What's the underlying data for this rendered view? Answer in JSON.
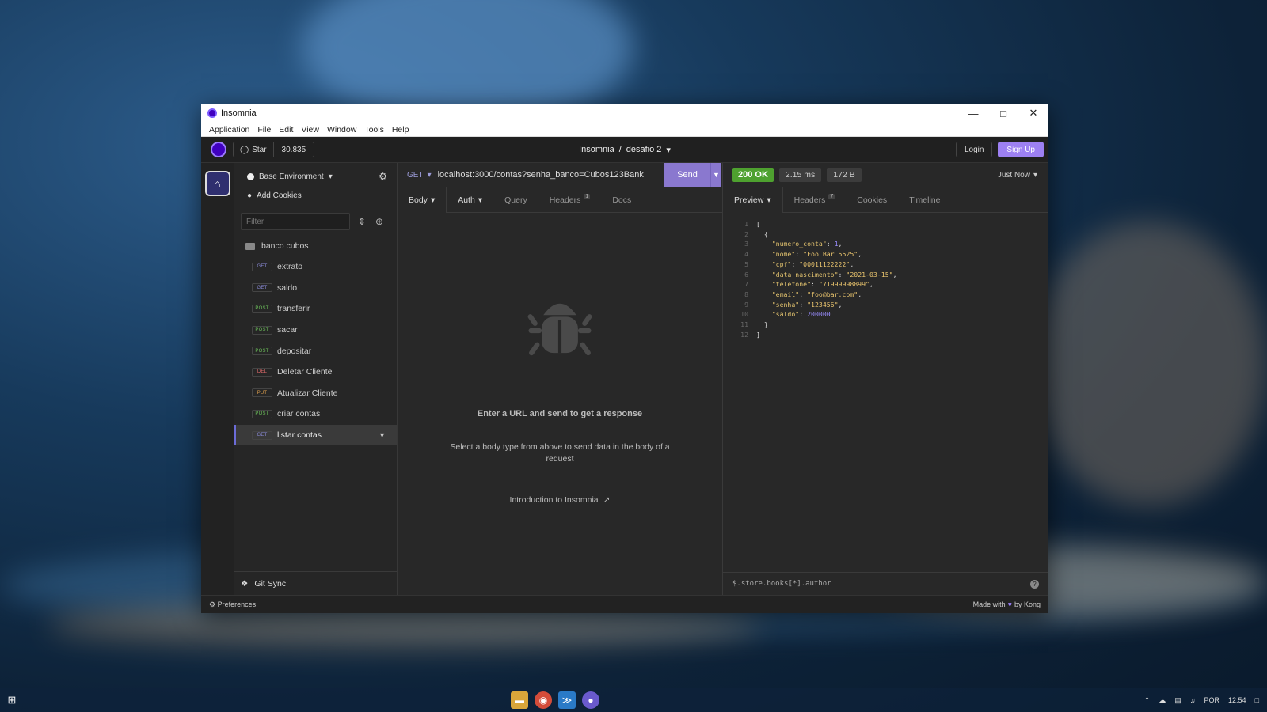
{
  "window": {
    "title": "Insomnia",
    "menu": [
      "Application",
      "File",
      "Edit",
      "View",
      "Window",
      "Tools",
      "Help"
    ],
    "controls": {
      "minimize": "—",
      "maximize": "□",
      "close": "✕"
    }
  },
  "topbar": {
    "star_label": "Star",
    "star_count": "30.835",
    "breadcrumb_app": "Insomnia",
    "breadcrumb_sep": "/",
    "breadcrumb_project": "desafio 2",
    "login_label": "Login",
    "signup_label": "Sign Up"
  },
  "sidebar": {
    "environment": "Base Environment",
    "add_cookies": "Add Cookies",
    "filter_placeholder": "Filter",
    "folder": "banco cubos",
    "requests": [
      {
        "method": "GET",
        "name": "extrato"
      },
      {
        "method": "GET",
        "name": "saldo"
      },
      {
        "method": "POST",
        "name": "transferir"
      },
      {
        "method": "POST",
        "name": "sacar"
      },
      {
        "method": "POST",
        "name": "depositar"
      },
      {
        "method": "DEL",
        "name": "Deletar Cliente"
      },
      {
        "method": "PUT",
        "name": "Atualizar Cliente"
      },
      {
        "method": "POST",
        "name": "criar contas"
      },
      {
        "method": "GET",
        "name": "listar contas",
        "active": true
      }
    ],
    "git_sync": "Git Sync"
  },
  "request": {
    "method": "GET",
    "url": "localhost:3000/contas?senha_banco=Cubos123Bank",
    "send_label": "Send",
    "tabs": [
      "Body",
      "Auth",
      "Query",
      "Headers",
      "Docs"
    ],
    "headers_count": "1",
    "empty_title": "Enter a URL and send to get a response",
    "empty_sub": "Select a body type from above to send data in the body of a request",
    "intro_link": "Introduction to Insomnia"
  },
  "response": {
    "status": "200 OK",
    "time": "2.15 ms",
    "size": "172 B",
    "when": "Just Now",
    "tabs": [
      "Preview",
      "Headers",
      "Cookies",
      "Timeline"
    ],
    "headers_count": "7",
    "body_lines": [
      "[",
      "  {",
      "    \"numero_conta\": 1,",
      "    \"nome\": \"Foo Bar 5525\",",
      "    \"cpf\": \"00011122222\",",
      "    \"data_nascimento\": \"2021-03-15\",",
      "    \"telefone\": \"71999998899\",",
      "    \"email\": \"foo@bar.com\",",
      "    \"senha\": \"123456\",",
      "    \"saldo\": 200000",
      "  }",
      "]"
    ],
    "filter_placeholder": "$.store.books[*].author"
  },
  "statusbar": {
    "preferences": "Preferences",
    "made_with": "Made with",
    "by": "by Kong"
  },
  "taskbar": {
    "tray_lang": "POR",
    "tray_time": "12:54"
  },
  "colors": {
    "accent": "#9d80f2",
    "status_ok": "#4ea12f",
    "method_get": "#8b8bd8",
    "method_post": "#6cbf5a",
    "method_delete": "#e16b6b",
    "method_put": "#e0a04d"
  }
}
